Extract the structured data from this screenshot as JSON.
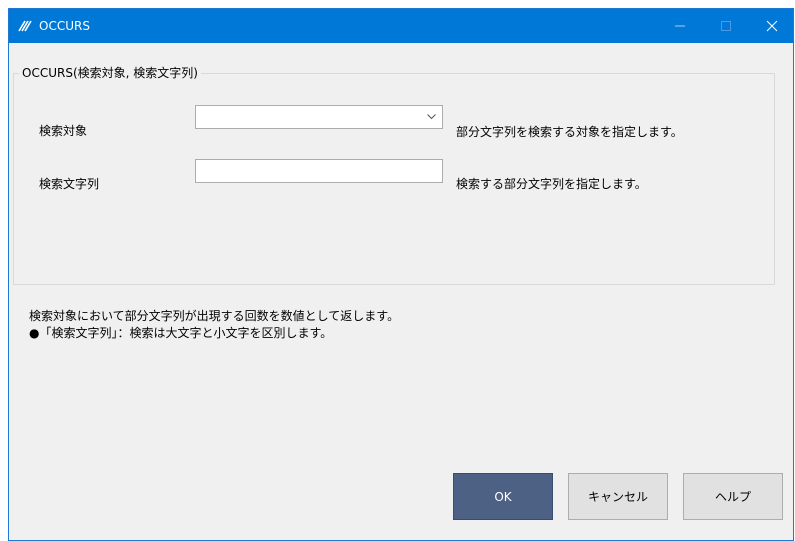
{
  "window": {
    "title": "OCCURS"
  },
  "group": {
    "label": "OCCURS(検索対象, 検索文字列)"
  },
  "fields": {
    "target_label": "検索対象",
    "target_value": "",
    "target_desc": "部分文字列を検索する対象を指定します。",
    "search_label": "検索文字列",
    "search_value": "",
    "search_desc": "検索する部分文字列を指定します。"
  },
  "description": {
    "line1": "検索対象において部分文字列が出現する回数を数値として返します。",
    "line2": "●「検索文字列」：検索は大文字と小文字を区別します。"
  },
  "buttons": {
    "ok": "OK",
    "cancel": "キャンセル",
    "help": "ヘルプ"
  },
  "colors": {
    "titlebar": "#0078d7",
    "ok_button": "#4d6185"
  },
  "icons": [
    "app-icon",
    "minimize-icon",
    "maximize-icon",
    "close-icon",
    "chevron-down-icon"
  ]
}
